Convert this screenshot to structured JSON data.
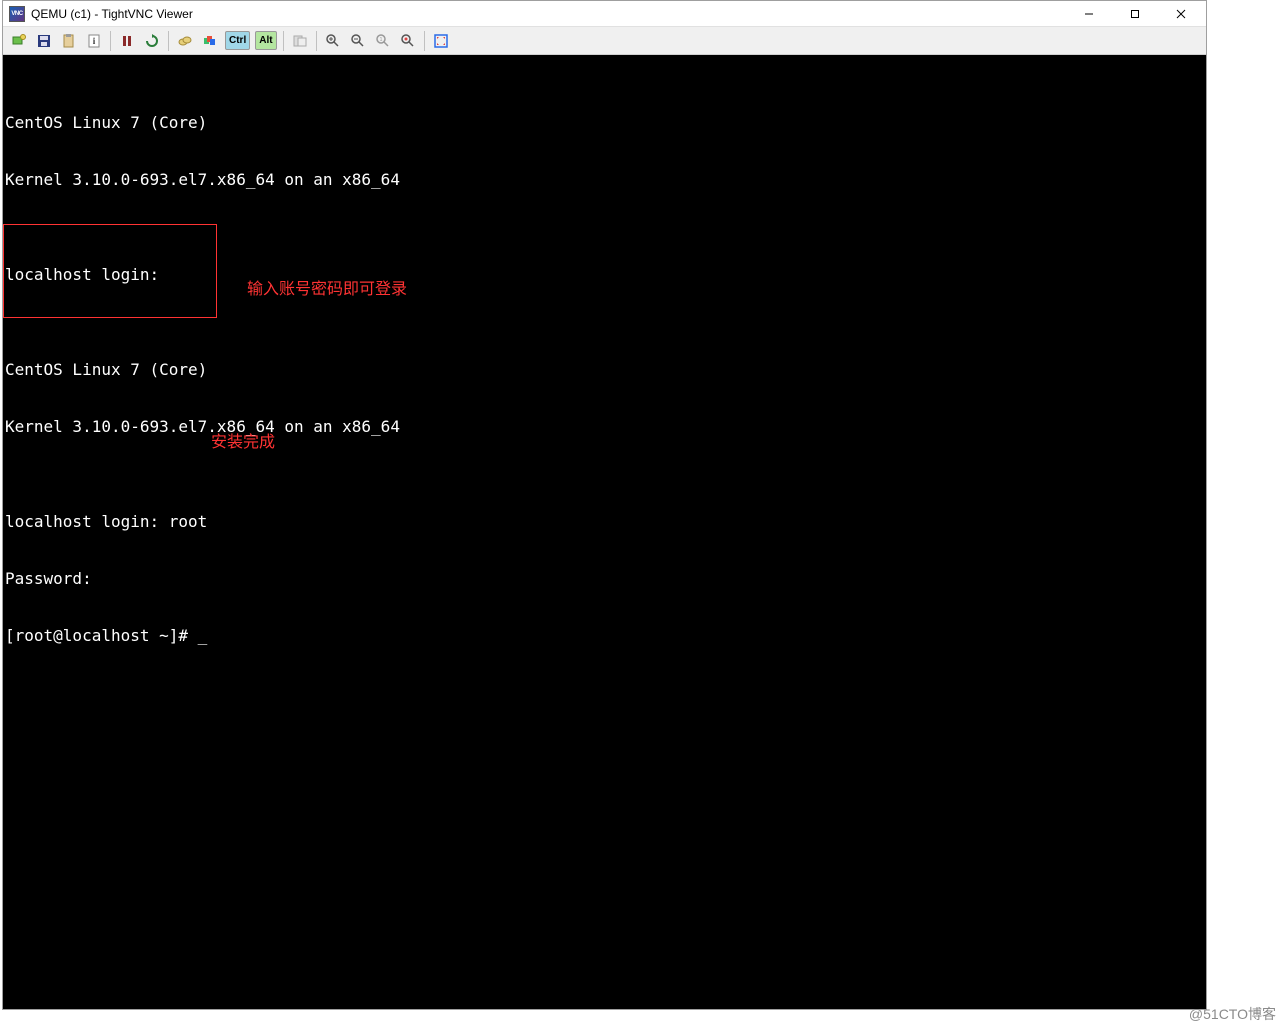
{
  "window": {
    "title": "QEMU (c1) - TightVNC Viewer"
  },
  "toolbar": {
    "ctrl_label": "Ctrl",
    "alt_label": "Alt",
    "icons": {
      "new_conn": "new-connection-icon",
      "save": "save-icon",
      "options": "options-clipboard-icon",
      "info": "connection-info-icon",
      "pause": "pause-icon",
      "refresh": "refresh-icon",
      "cad": "ctrl-alt-del-icon",
      "ctrlesc": "ctrl-esc-icon",
      "ctrl": "ctrl-key-icon",
      "alt": "alt-key-icon",
      "transfer": "file-transfer-icon",
      "zoom_in": "zoom-in-icon",
      "zoom_out": "zoom-out-icon",
      "zoom_100": "zoom-100-icon",
      "zoom_auto": "zoom-auto-icon",
      "fullscreen": "fullscreen-icon"
    }
  },
  "terminal": {
    "lines": [
      "CentOS Linux 7 (Core)",
      "Kernel 3.10.0-693.el7.x86_64 on an x86_64",
      "",
      "localhost login:",
      "",
      "CentOS Linux 7 (Core)",
      "Kernel 3.10.0-693.el7.x86_64 on an x86_64",
      "",
      "localhost login: root",
      "Password:",
      "[root@localhost ~]# _"
    ]
  },
  "annotations": {
    "login_hint": "输入账号密码即可登录",
    "done": "安装完成"
  },
  "watermark": "@51CTO博客"
}
